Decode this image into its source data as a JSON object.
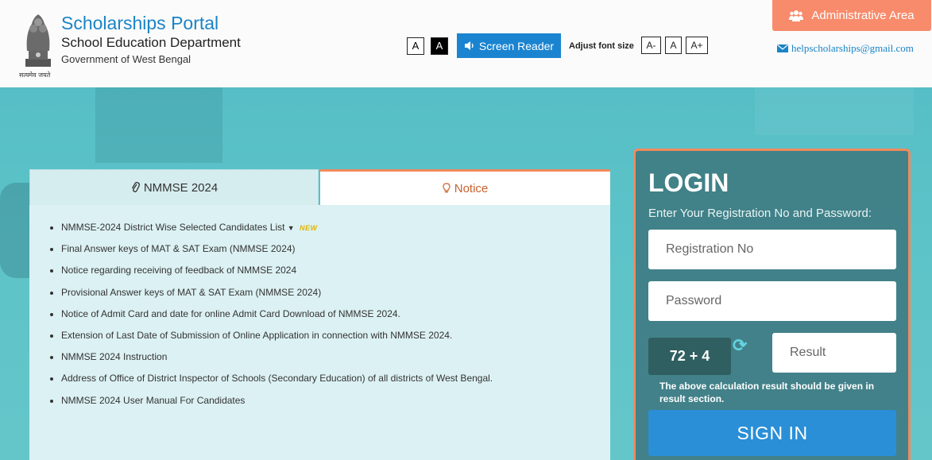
{
  "header": {
    "portal_title": "Scholarships Portal",
    "department": "School Education Department",
    "government": "Government of West Bengal",
    "emblem_motto": "सत्यमेव जयते"
  },
  "accessibility": {
    "contrast_light": "A",
    "contrast_dark": "A",
    "screen_reader_label": "Screen Reader",
    "adjust_font_label": "Adjust font size",
    "font_decrease": "A-",
    "font_normal": "A",
    "font_increase": "A+"
  },
  "admin": {
    "label": "Administrative Area",
    "email": "helpscholarships@gmail.com"
  },
  "tabs": {
    "nmmse_label": "NMMSE 2024",
    "notice_label": "Notice"
  },
  "notices": [
    "NMMSE-2024 District Wise Selected Candidates List",
    "Final Answer keys of MAT & SAT Exam (NMMSE 2024)",
    "Notice regarding receiving of feedback of NMMSE 2024",
    "Provisional Answer keys of MAT & SAT Exam (NMMSE 2024)",
    "Notice of Admit Card and date for online Admit Card Download of NMMSE 2024.",
    "Extension of Last Date of Submission of Online Application in connection with NMMSE 2024.",
    "NMMSE 2024 Instruction",
    "Address of Office of District Inspector of Schools (Secondary Education) of all districts of West Bengal.",
    "NMMSE 2024 User Manual For Candidates"
  ],
  "new_badge": "NEW",
  "login": {
    "title": "LOGIN",
    "subtitle": "Enter Your Registration No and Password:",
    "registration_placeholder": "Registration No",
    "password_placeholder": "Password",
    "captcha": "72 + 4",
    "result_placeholder": "Result",
    "captcha_note": "The above calculation result should be given in result section.",
    "signin_label": "SIGN IN"
  },
  "colors": {
    "brand_blue": "#1a84c6",
    "accent_orange": "#f78b6b",
    "hero_teal": "#5cc3c8",
    "login_bg": "#3e7880",
    "signin_blue": "#2a8fd6"
  },
  "icons": {
    "screen_reader": "speaker-icon",
    "admin": "users-icon",
    "email": "envelope-icon",
    "nmmse_tab": "paperclip-icon",
    "notice_tab": "lightbulb-icon",
    "captcha_refresh": "refresh-icon"
  }
}
